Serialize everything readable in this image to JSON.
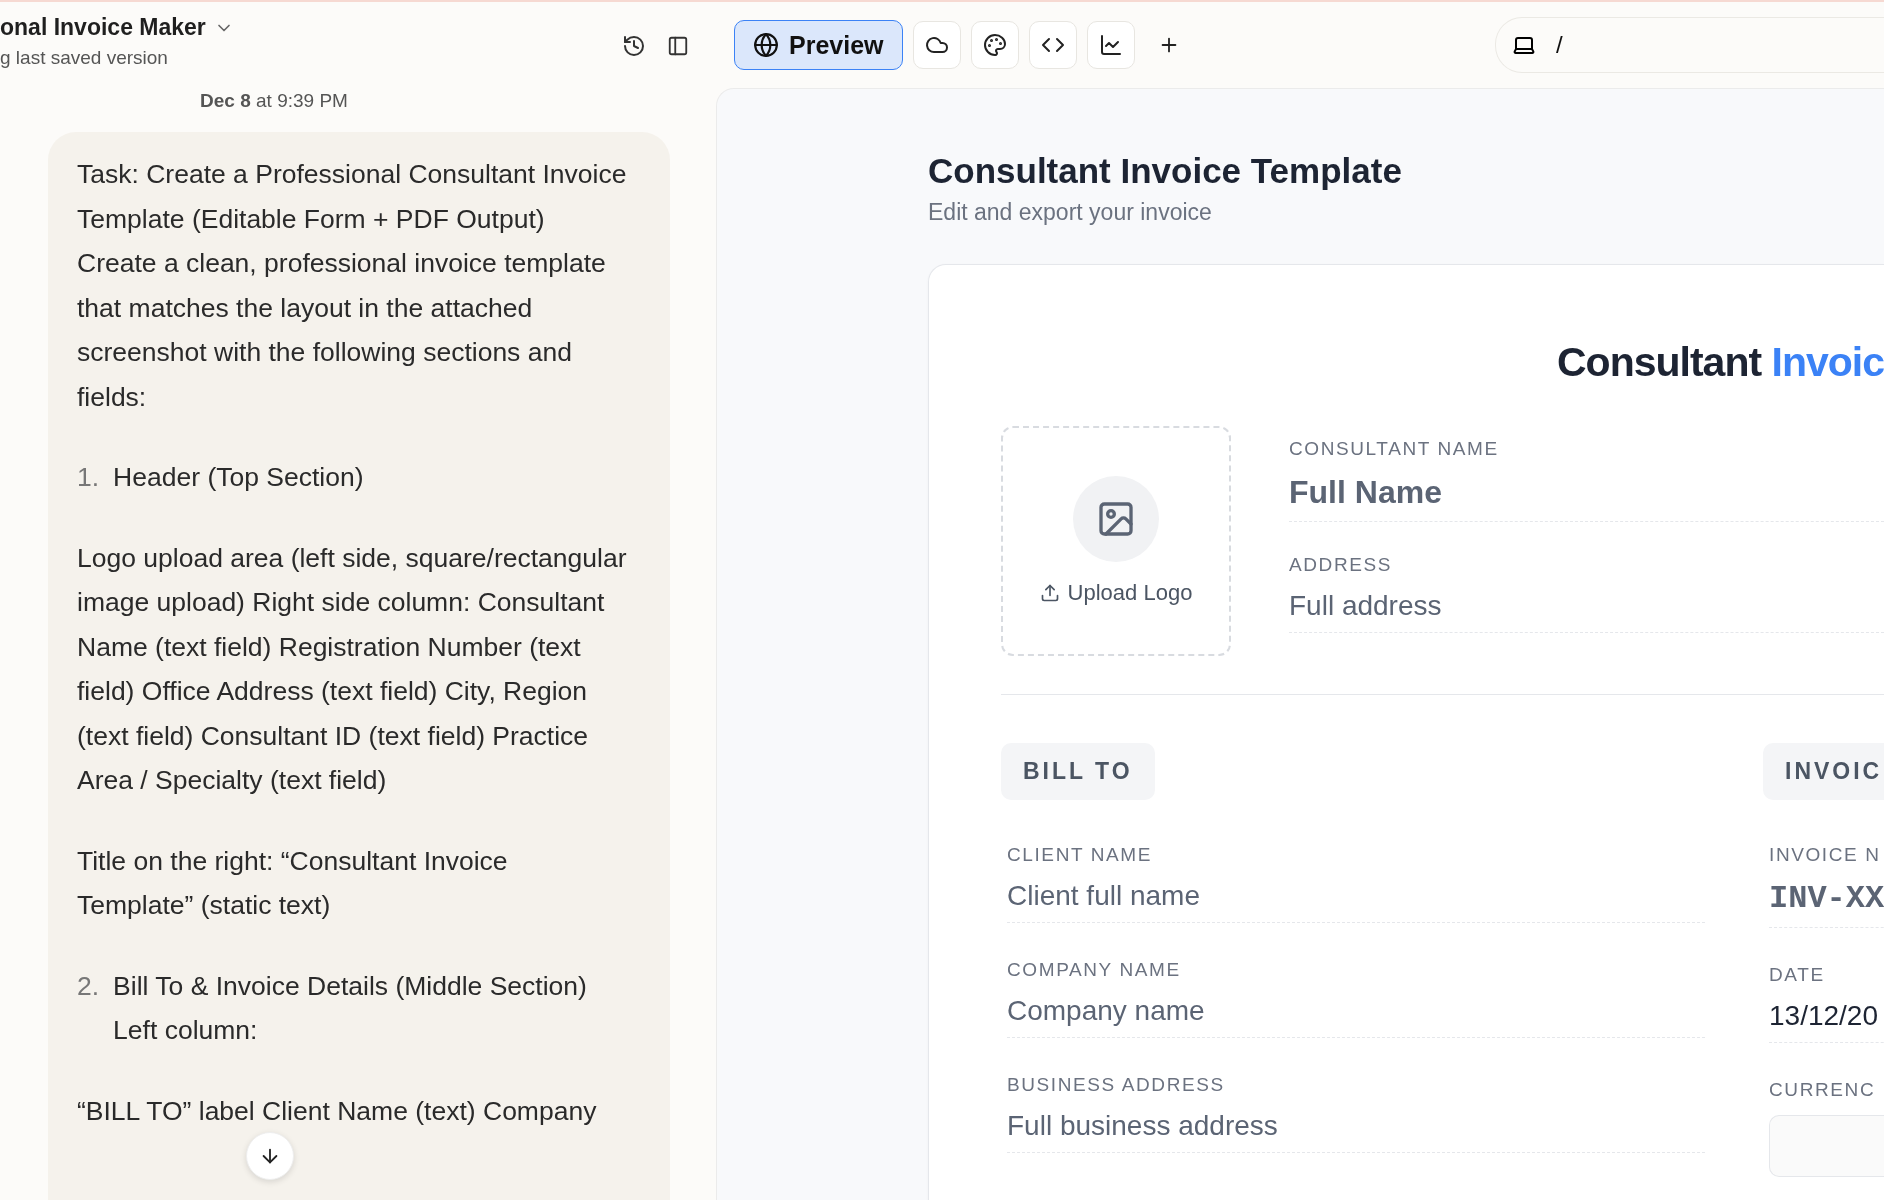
{
  "header": {
    "title": "onal Invoice Maker",
    "subtitle": "g last saved version"
  },
  "toolbar": {
    "preview_label": "Preview",
    "preview_selected": true,
    "address": "/"
  },
  "chat": {
    "date": "Dec 8",
    "time": "at 9:39 PM",
    "paragraphs": [
      {
        "kind": "text",
        "text": "Task: Create a Professional Consultant Invoice Template (Editable Form + PDF Output) Create a clean, professional invoice template that matches the layout in the attached screenshot with the following sections and fields:"
      },
      {
        "kind": "numbered",
        "number": "1.",
        "text": "Header (Top Section)"
      },
      {
        "kind": "text",
        "text": "Logo upload area (left side, square/rectangular image upload) Right side column: Consultant Name (text field) Registration Number (text field) Office Address (text field) City, Region (text field) Consultant ID (text field) Practice Area / Specialty (text field)"
      },
      {
        "kind": "text",
        "text": "Title on the right: “Consultant Invoice Template” (static text)"
      },
      {
        "kind": "numbered",
        "number": "2.",
        "text": "Bill To & Invoice Details (Middle Section) Left column:"
      },
      {
        "kind": "text",
        "text": "“BILL TO” label Client Name (text) Company"
      }
    ]
  },
  "preview": {
    "title": "Consultant Invoice Template",
    "subtitle": "Edit and export your invoice",
    "invoice": {
      "title_dark": "Consultant",
      "title_accent": "Invoic",
      "upload_label": "Upload Logo",
      "consultant_fields": [
        {
          "label": "CONSULTANT NAME",
          "placeholder": "Full Name",
          "kind": "heading"
        },
        {
          "label": "ADDRESS",
          "placeholder": "Full address",
          "kind": "plain"
        }
      ],
      "bill_to": {
        "badge": "BILL TO",
        "fields": [
          {
            "label": "CLIENT NAME",
            "placeholder": "Client full name",
            "kind": "plain"
          },
          {
            "label": "COMPANY NAME",
            "placeholder": "Company name",
            "kind": "plain"
          },
          {
            "label": "BUSINESS ADDRESS",
            "placeholder": "Full business address",
            "kind": "plain"
          }
        ]
      },
      "details": {
        "badge": "INVOIC",
        "fields": [
          {
            "label": "INVOICE N",
            "placeholder": "INV-XX",
            "kind": "mono"
          },
          {
            "label": "DATE",
            "value": "13/12/20",
            "kind": "plain"
          },
          {
            "label": "CURRENC",
            "kind": "select"
          }
        ]
      }
    }
  }
}
